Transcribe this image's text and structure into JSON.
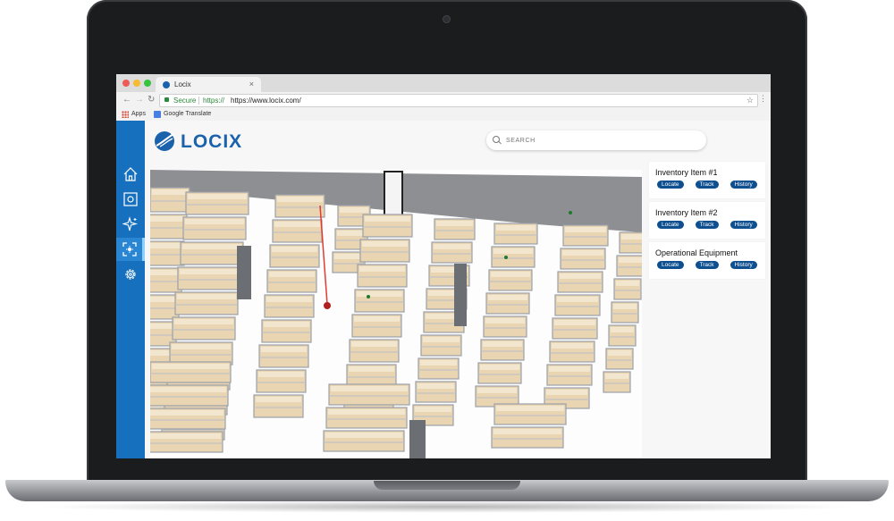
{
  "browser": {
    "tab_title": "Locix",
    "tab_close": "×",
    "secure_label": "Secure",
    "url_scheme": "https://",
    "url": "https://www.locix.com/",
    "bookmarks": [
      "Apps",
      "Google Translate"
    ]
  },
  "app": {
    "brand": "LOCIX",
    "brand_color": "#1a62ab",
    "sidebar_color": "#1670bd",
    "search_placeholder": "SEARCH",
    "sidebar_items": [
      {
        "icon": "home-icon"
      },
      {
        "icon": "square-target-icon"
      },
      {
        "icon": "sparkle-icon"
      },
      {
        "icon": "focus-icon",
        "active": true
      },
      {
        "icon": "gear-icon"
      }
    ],
    "items": [
      {
        "name": "Inventory Item #1",
        "actions": [
          "Locate",
          "Track",
          "History"
        ]
      },
      {
        "name": "Inventory Item #2",
        "actions": [
          "Locate",
          "Track",
          "History"
        ]
      },
      {
        "name": "Operational Equipment",
        "actions": [
          "Locate",
          "Track",
          "History"
        ]
      }
    ]
  }
}
